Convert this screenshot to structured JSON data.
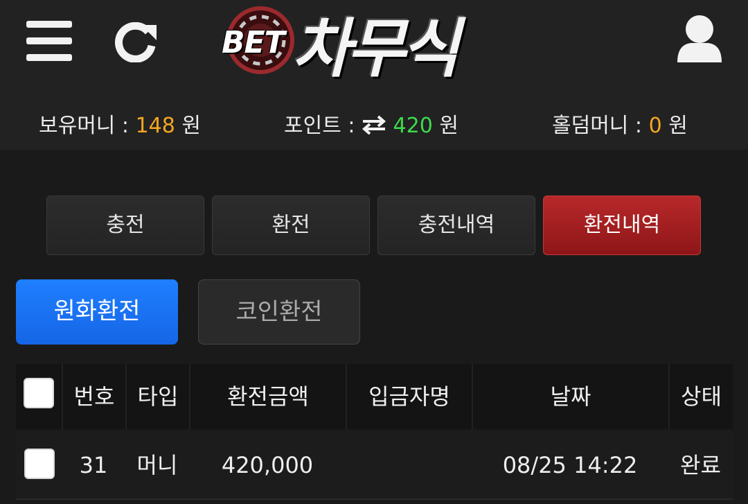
{
  "header": {
    "logo_bet": "BET",
    "logo_name": "차무식"
  },
  "balances": {
    "money_label": "보유머니 :",
    "money_value": "148",
    "point_label": "포인트 :",
    "point_value": "420",
    "holdem_label": "홀덤머니 :",
    "holdem_value": "0",
    "unit": "원"
  },
  "tabs": [
    {
      "label": "충전"
    },
    {
      "label": "환전"
    },
    {
      "label": "충전내역"
    },
    {
      "label": "환전내역",
      "active": true
    }
  ],
  "subtabs": [
    {
      "label": "원화환전",
      "active": true
    },
    {
      "label": "코인환전"
    }
  ],
  "table": {
    "headers": [
      "번호",
      "타입",
      "환전금액",
      "입금자명",
      "날짜",
      "상태"
    ],
    "rows": [
      {
        "no": "31",
        "type": "머니",
        "amount": "420,000",
        "name": "",
        "date": "08/25 14:22",
        "status": "완료"
      }
    ]
  },
  "colors": {
    "accent_red": "#b8282a",
    "accent_blue": "#1f7fff",
    "money_orange": "#f5a623",
    "point_green": "#3ddc4c"
  }
}
